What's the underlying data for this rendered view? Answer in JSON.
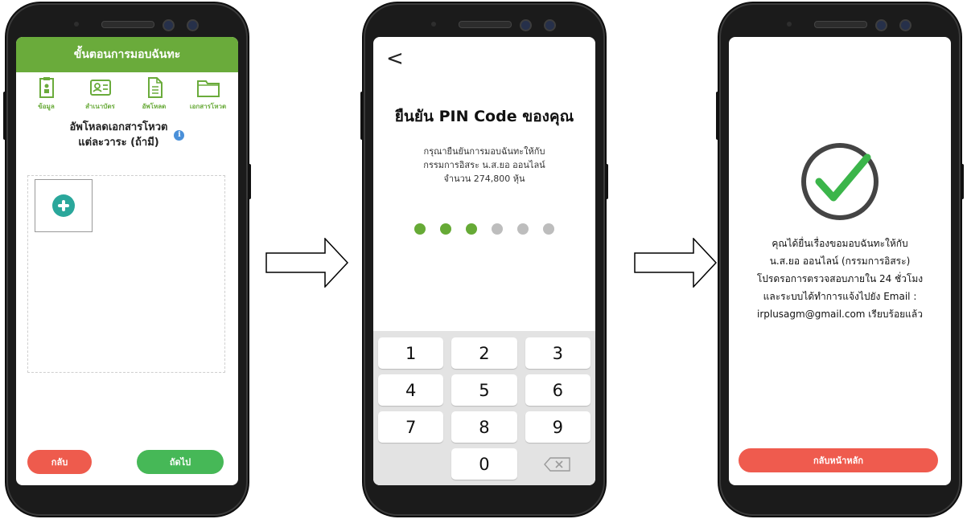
{
  "phone1": {
    "header_title": "ขั้นตอนการมอบฉันทะ",
    "steps": [
      {
        "label": "ข้อมูล",
        "icon": "clipboard-icon"
      },
      {
        "label": "สำเนาบัตร",
        "icon": "id-card-icon"
      },
      {
        "label": "อัพโหลด",
        "icon": "document-icon"
      },
      {
        "label": "เอกสารโหวต",
        "icon": "folder-icon"
      }
    ],
    "upload_title_line1": "อัพโหลดเอกสารโหวต",
    "upload_title_line2": "แต่ละวาระ (ถ้ามี)",
    "info_glyph": "i",
    "back_label": "กลับ",
    "next_label": "ถัดไป",
    "colors": {
      "primary": "#6aab3b",
      "back": "#ee5b4d",
      "next": "#46b857",
      "add": "#2aa79b"
    }
  },
  "phone2": {
    "back_glyph": "<",
    "title": "ยืนยัน PIN Code ของคุณ",
    "desc_line1": "กรุณายืนยันการมอบฉันทะให้กับ",
    "desc_line2": "กรรมการอิสระ น.ส.ยอ ออนไลน์",
    "desc_line3": "จำนวน 274,800 หุ้น",
    "pin_length": 6,
    "pin_entered": 3,
    "keys": [
      "1",
      "2",
      "3",
      "4",
      "5",
      "6",
      "7",
      "8",
      "9",
      "",
      "0",
      "⌫"
    ],
    "colors": {
      "dot_filled": "#66aa36",
      "dot_empty": "#bdbdbd",
      "keypad_bg": "#e3e3e3"
    }
  },
  "phone3": {
    "message_line1": "คุณได้ยื่นเรื่องขอมอบฉันทะให้กับ",
    "message_line2": "น.ส.ยอ ออนไลน์ (กรรมการอิสระ)",
    "message_line3": "โปรดรอการตรวจสอบภายใน 24 ชั่วโมง",
    "message_line4": "และระบบได้ทำการแจ้งไปยัง Email :",
    "message_line5": "irplusagm@gmail.com เรียบร้อยแล้ว",
    "home_label": "กลับหน้าหลัก",
    "colors": {
      "check": "#3bb54a",
      "ring": "#444444",
      "home": "#ef5b4e"
    }
  }
}
